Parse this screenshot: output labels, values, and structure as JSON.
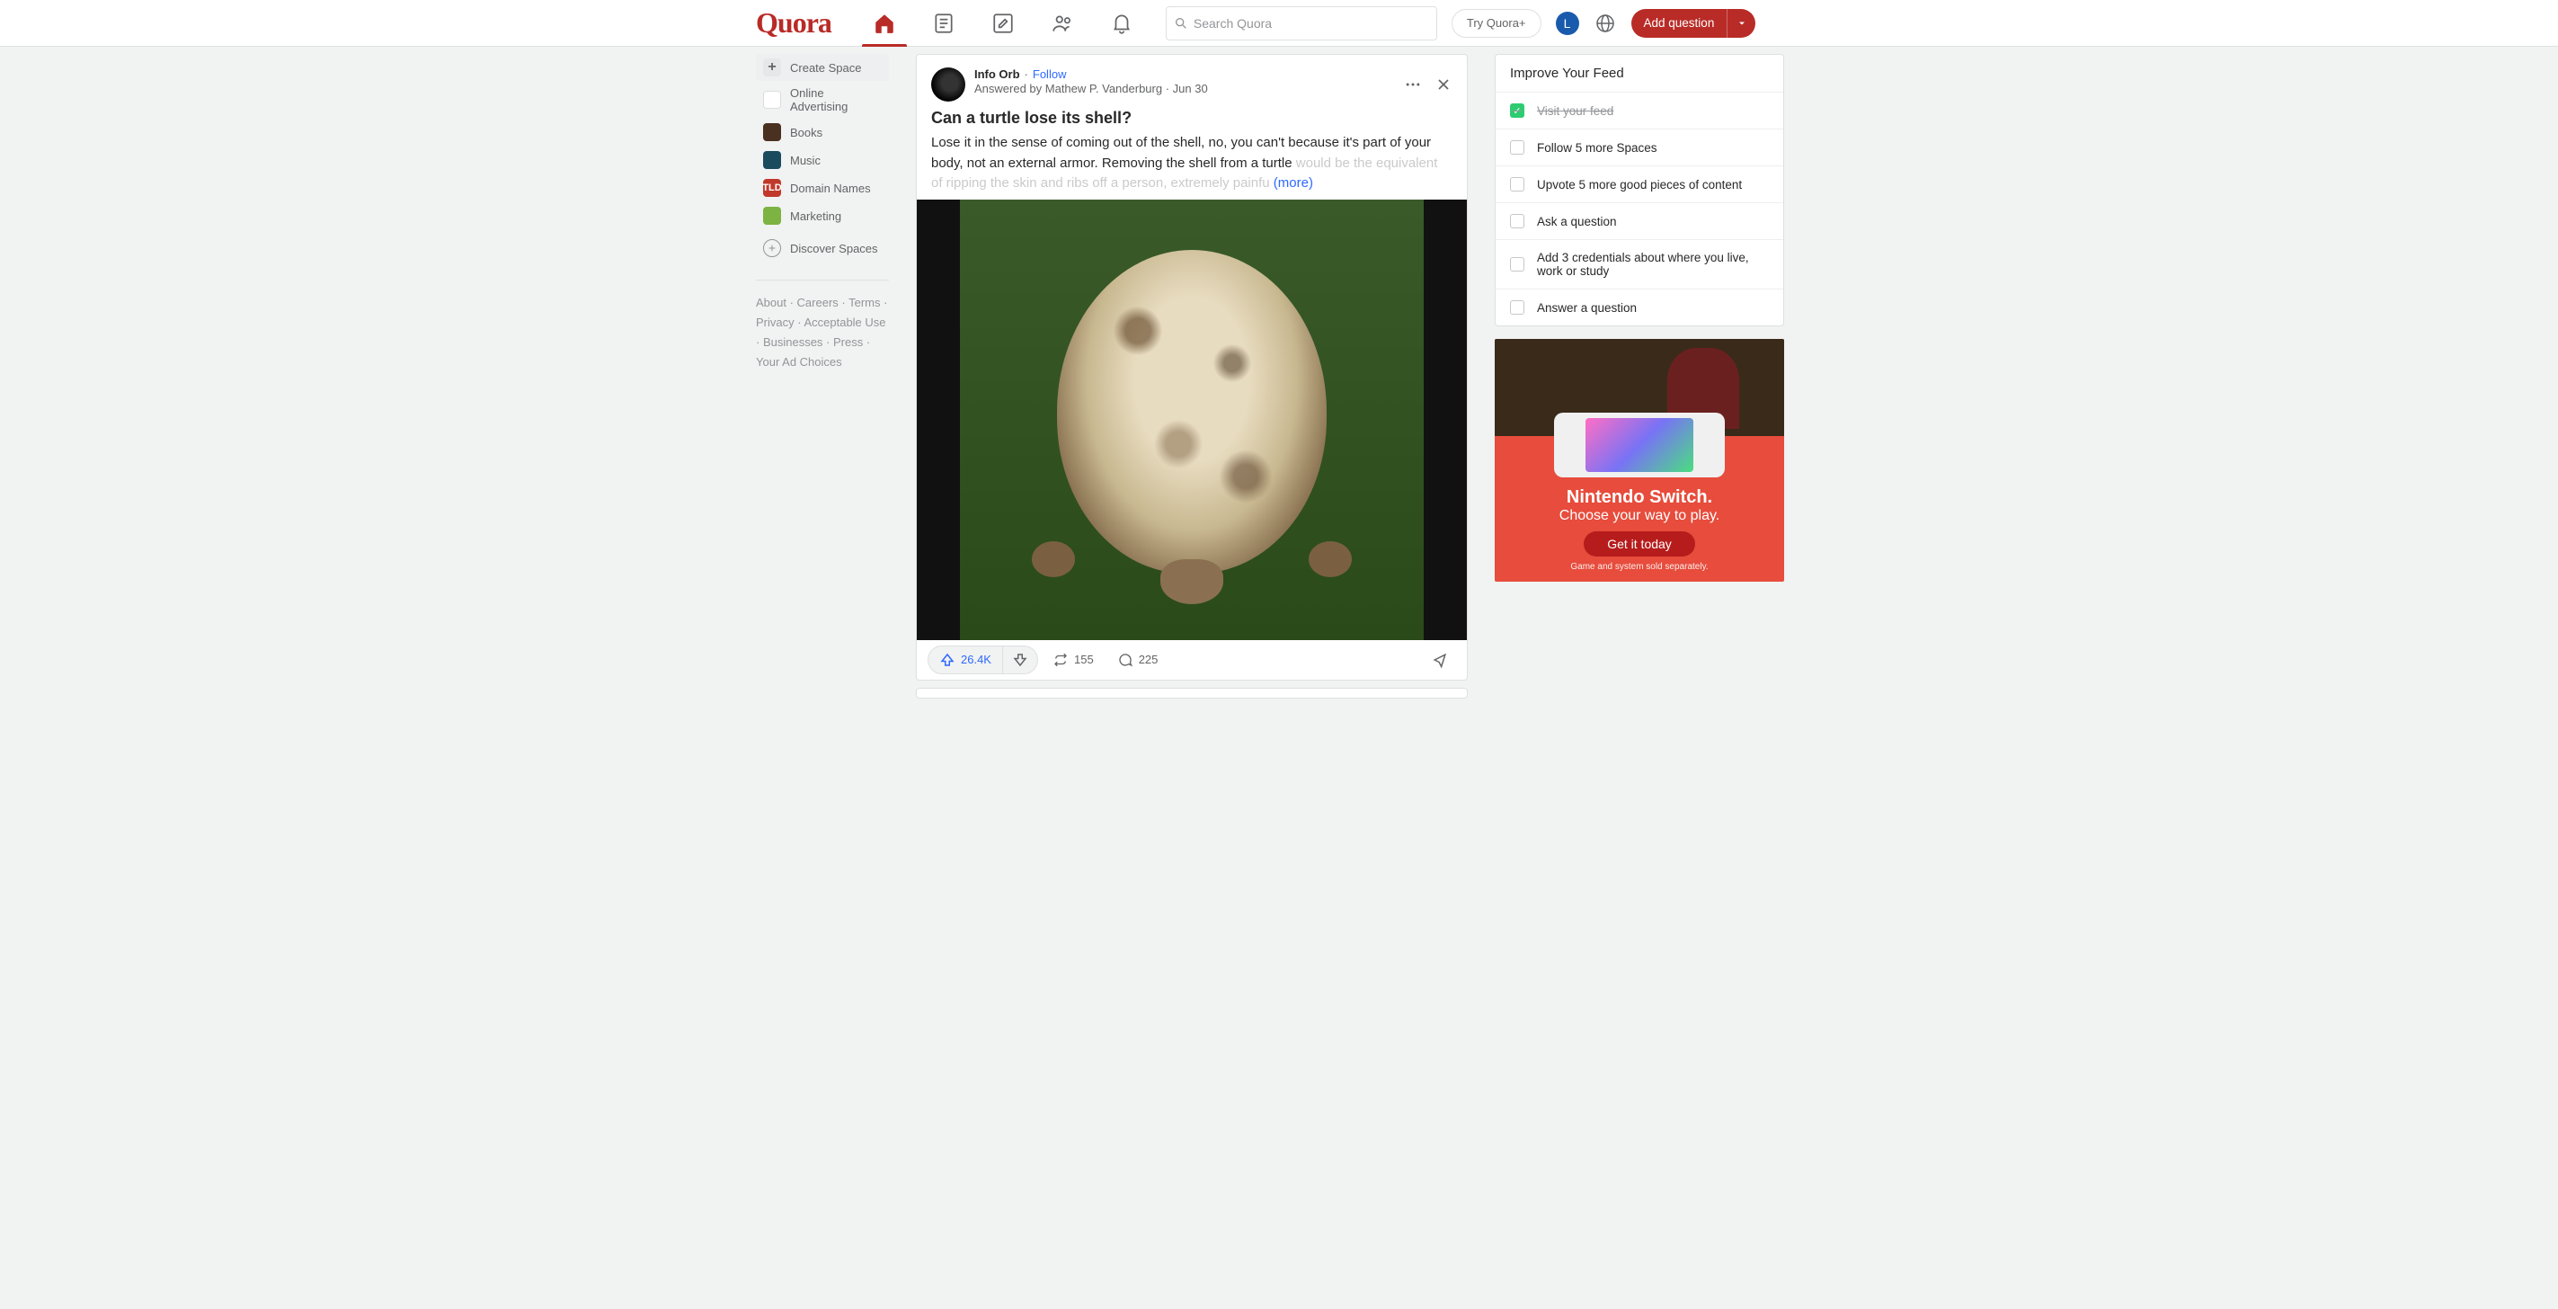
{
  "header": {
    "logo": "Quora",
    "search_placeholder": "Search Quora",
    "try_plus": "Try Quora+",
    "avatar_initial": "L",
    "add_question": "Add question"
  },
  "sidebar": {
    "create": "Create Space",
    "items": [
      {
        "label": "Online Advertising"
      },
      {
        "label": "Books"
      },
      {
        "label": "Music"
      },
      {
        "label": "Domain Names"
      },
      {
        "label": "Marketing"
      }
    ],
    "discover": "Discover Spaces"
  },
  "footer": {
    "about": "About",
    "careers": "Careers",
    "terms": "Terms",
    "privacy": "Privacy",
    "acceptable": "Acceptable Use",
    "businesses": "Businesses",
    "press": "Press",
    "choices": "Your Ad Choices"
  },
  "post": {
    "author": "Info Orb",
    "follow": "Follow",
    "answered_prefix": "Answered by ",
    "answered_by": "Mathew P. Vanderburg",
    "date": "Jun 30",
    "question": "Can a turtle lose its shell?",
    "body_visible": "Lose it in the sense of coming out of the shell, no, you can't because it's part of your body, not an external armor. Removing the shell from a turtle ",
    "body_faded": "would be the equivalent of ripping the skin and ribs off a person, extremely painfu",
    "more": "(more)",
    "upvotes": "26.4K",
    "shares": "155",
    "comments": "225"
  },
  "improve": {
    "title": "Improve Your Feed",
    "tasks": [
      {
        "label": "Visit your feed",
        "done": true
      },
      {
        "label": "Follow 5 more Spaces",
        "done": false
      },
      {
        "label": "Upvote 5 more good pieces of content",
        "done": false
      },
      {
        "label": "Ask a question",
        "done": false
      },
      {
        "label": "Add 3 credentials about where you live, work or study",
        "done": false
      },
      {
        "label": "Answer a question",
        "done": false
      }
    ]
  },
  "ad": {
    "badge": "NINTENDO\nSWITCH",
    "title": "Nintendo Switch.",
    "subtitle": "Choose your way to play.",
    "cta": "Get it today",
    "fine": "Game and system sold separately."
  }
}
